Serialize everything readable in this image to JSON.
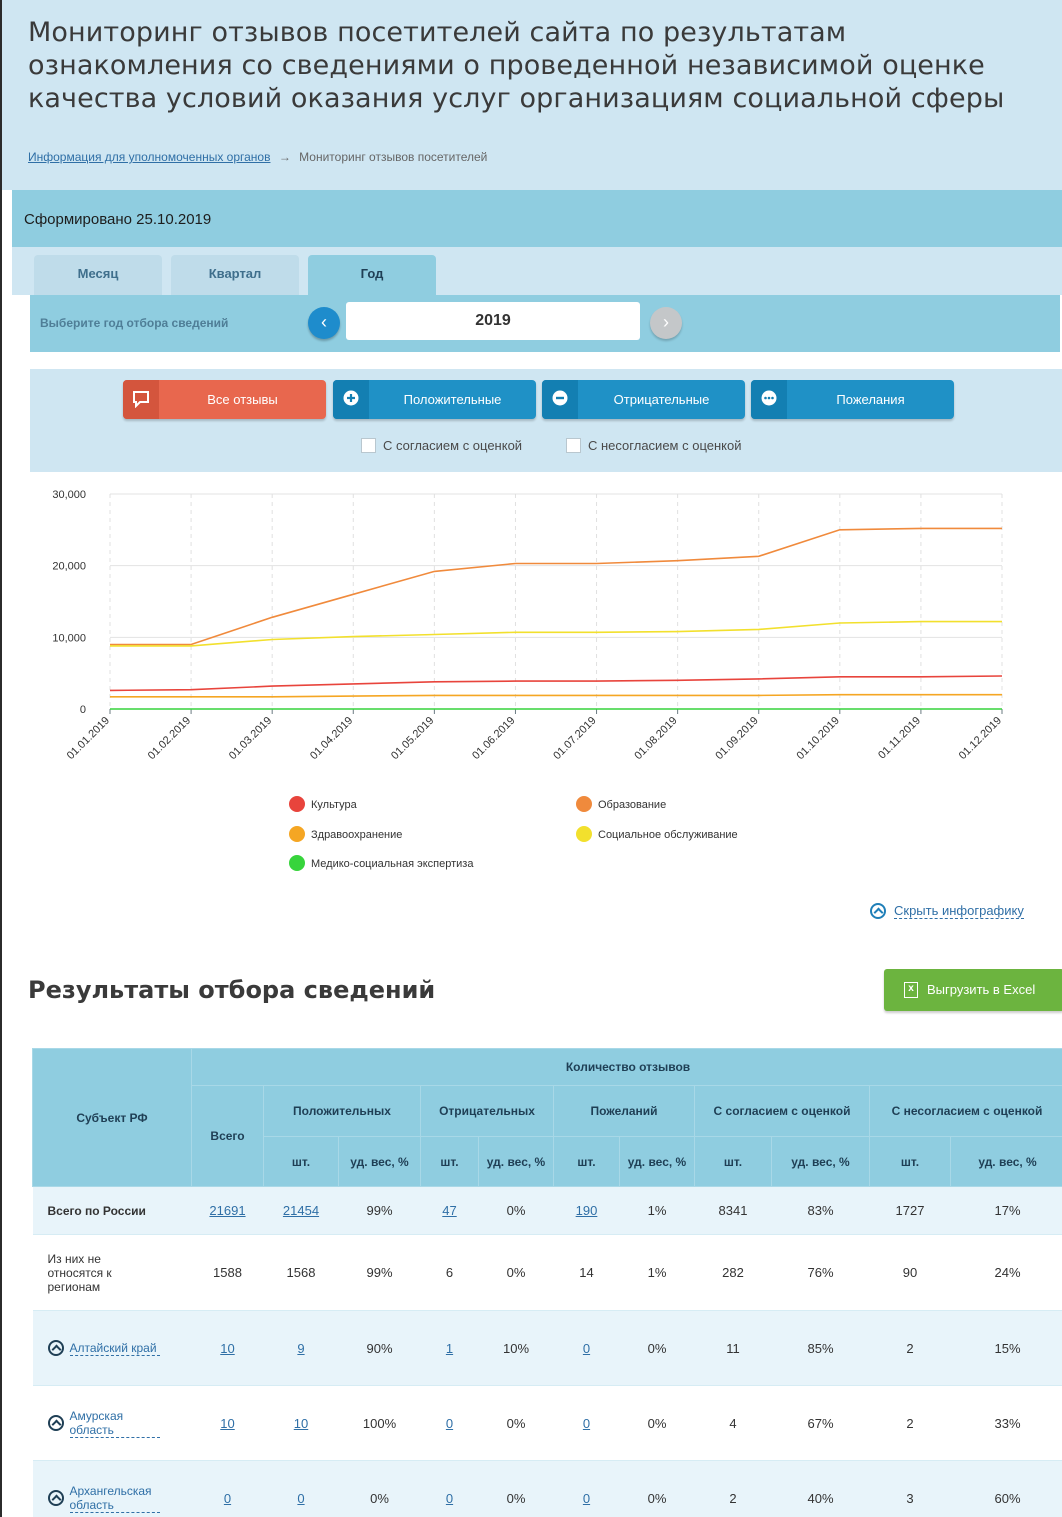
{
  "header": {
    "title": "Мониторинг отзывов посетителей сайта по результатам ознакомления со сведениями о проведенной независимой оценке качества условий оказания услуг организациям социальной сферы",
    "breadcrumb_link": "Информация для уполномоченных органов",
    "breadcrumb_sep": "→",
    "breadcrumb_current": "Мониторинг отзывов посетителей"
  },
  "formed": "Сформировано 25.10.2019",
  "tabs": [
    {
      "label": "Месяц",
      "active": false
    },
    {
      "label": "Квартал",
      "active": false
    },
    {
      "label": "Год",
      "active": true
    }
  ],
  "period": {
    "label": "Выберите год отбора сведений",
    "value": "2019",
    "prev_icon": "chevron-left-icon",
    "next_icon": "chevron-right-icon"
  },
  "filters": {
    "buttons": [
      {
        "label": "Все отзывы",
        "icon": "comment-icon",
        "active": true
      },
      {
        "label": "Положительные",
        "icon": "plus-bubble-icon",
        "active": false
      },
      {
        "label": "Отрицательные",
        "icon": "minus-bubble-icon",
        "active": false
      },
      {
        "label": "Пожелания",
        "icon": "dots-bubble-icon",
        "active": false
      }
    ],
    "checkboxes": [
      {
        "label": "С согласием с оценкой",
        "checked": false
      },
      {
        "label": "С несогласием с оценкой",
        "checked": false
      }
    ]
  },
  "chart_data": {
    "type": "line",
    "x": [
      "01.01.2019",
      "01.02.2019",
      "01.03.2019",
      "01.04.2019",
      "01.05.2019",
      "01.06.2019",
      "01.07.2019",
      "01.08.2019",
      "01.09.2019",
      "01.10.2019",
      "01.11.2019",
      "01.12.2019"
    ],
    "ylim": [
      0,
      30000
    ],
    "yticks": [
      "0",
      "10,000",
      "20,000",
      "30,000"
    ],
    "ytick_values": [
      0,
      10000,
      20000,
      30000
    ],
    "grid": true,
    "series": [
      {
        "name": "Культура",
        "color": "#e8443c",
        "values": [
          2600,
          2700,
          3200,
          3500,
          3800,
          3900,
          3900,
          4000,
          4200,
          4500,
          4500,
          4600
        ]
      },
      {
        "name": "Образование",
        "color": "#f08a3c",
        "values": [
          9000,
          9000,
          12800,
          16000,
          19200,
          20300,
          20300,
          20700,
          21300,
          25000,
          25200,
          25200
        ]
      },
      {
        "name": "Здравоохранение",
        "color": "#f5a623",
        "values": [
          1700,
          1700,
          1700,
          1800,
          1900,
          1900,
          1900,
          1900,
          1900,
          2000,
          2000,
          2000
        ]
      },
      {
        "name": "Социальное обслуживание",
        "color": "#f2e02d",
        "values": [
          8800,
          8800,
          9700,
          10100,
          10400,
          10700,
          10700,
          10800,
          11100,
          12000,
          12200,
          12200
        ]
      },
      {
        "name": "Медико-социальная экспертиза",
        "color": "#37d43c",
        "values": [
          0,
          0,
          0,
          0,
          0,
          0,
          0,
          0,
          0,
          0,
          0,
          0
        ]
      }
    ],
    "legend_order": [
      {
        "name": "Культура",
        "color": "#e8443c"
      },
      {
        "name": "Образование",
        "color": "#f08a3c"
      },
      {
        "name": "Здравоохранение",
        "color": "#f5a623"
      },
      {
        "name": "Социальное обслуживание",
        "color": "#f2e02d"
      },
      {
        "name": "Медико-социальная экспертиза",
        "color": "#37d43c"
      }
    ]
  },
  "hide_infographic": "Скрыть инфографику",
  "results": {
    "title": "Результаты отбора сведений",
    "export_label": "Выгрузить в Excel",
    "export_icon": "excel-icon"
  },
  "table": {
    "headers": {
      "subject": "Субъект РФ",
      "count": "Количество отзывов",
      "total": "Всего",
      "positive": "Положительных",
      "negative": "Отрицательных",
      "wishes": "Пожеланий",
      "agree": "С согласием с оценкой",
      "disagree": "С несогласием с оценкой",
      "pcs": "шт.",
      "share": "уд. вес, %"
    },
    "rows": [
      {
        "subject": "Всего по России",
        "total": "21691",
        "pos": "21454",
        "pos_pct": "99%",
        "neg": "47",
        "neg_pct": "0%",
        "wish": "190",
        "wish_pct": "1%",
        "agree": "8341",
        "agree_pct": "83%",
        "dis": "1727",
        "dis_pct": "17%"
      },
      {
        "subject": "Из них не относятся к регионам",
        "total": "1588",
        "pos": "1568",
        "pos_pct": "99%",
        "neg": "6",
        "neg_pct": "0%",
        "wish": "14",
        "wish_pct": "1%",
        "agree": "282",
        "agree_pct": "76%",
        "dis": "90",
        "dis_pct": "24%"
      },
      {
        "subject": "Алтайский край",
        "total": "10",
        "pos": "9",
        "pos_pct": "90%",
        "neg": "1",
        "neg_pct": "10%",
        "wish": "0",
        "wish_pct": "0%",
        "agree": "11",
        "agree_pct": "85%",
        "dis": "2",
        "dis_pct": "15%"
      },
      {
        "subject": "Амурская область",
        "total": "10",
        "pos": "10",
        "pos_pct": "100%",
        "neg": "0",
        "neg_pct": "0%",
        "wish": "0",
        "wish_pct": "0%",
        "agree": "4",
        "agree_pct": "67%",
        "dis": "2",
        "dis_pct": "33%"
      },
      {
        "subject": "Архангельская область",
        "total": "0",
        "pos": "0",
        "pos_pct": "0%",
        "neg": "0",
        "neg_pct": "0%",
        "wish": "0",
        "wish_pct": "0%",
        "agree": "2",
        "agree_pct": "40%",
        "dis": "3",
        "dis_pct": "60%"
      }
    ]
  }
}
